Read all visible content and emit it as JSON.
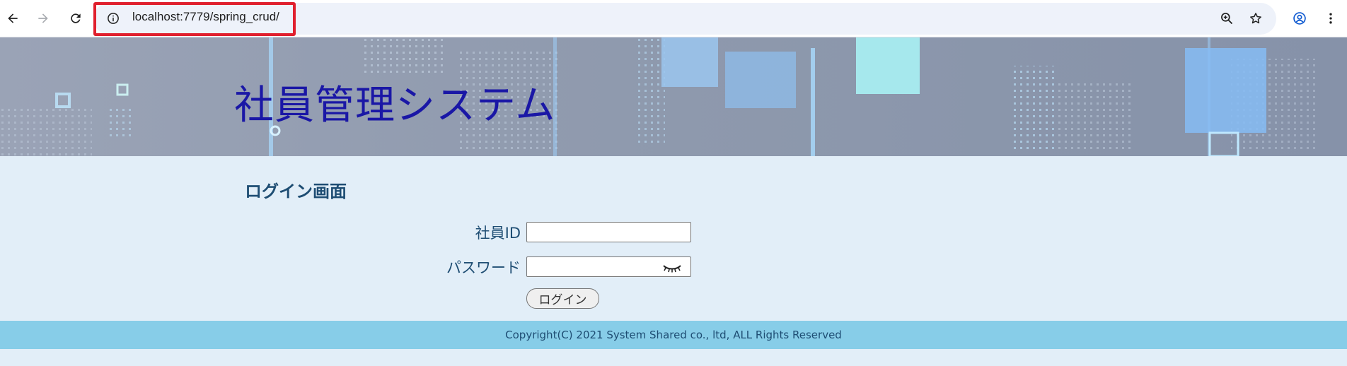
{
  "browser": {
    "url": "localhost:7779/spring_crud/",
    "icons": {
      "back": "arrow-left-icon",
      "forward": "arrow-right-icon",
      "reload": "reload-icon",
      "site_info": "info-icon",
      "zoom": "zoom-in-icon",
      "bookmark": "star-icon",
      "profile": "profile-icon",
      "menu": "kebab-menu-icon"
    }
  },
  "banner": {
    "title": "社員管理システム"
  },
  "login": {
    "heading": "ログイン画面",
    "employee_id_label": "社員ID",
    "employee_id_value": "",
    "password_label": "パスワード",
    "password_value": "",
    "password_toggle_icon": "eye-closed-icon",
    "submit_label": "ログイン"
  },
  "footer": {
    "copyright": "Copyright(C) 2021 System Shared co., ltd, ALL Rights Reserved"
  },
  "colors": {
    "title": "#1a17a6",
    "heading": "#1e4d73",
    "content_bg": "#e2eef8",
    "footer_bg": "#87cde8",
    "highlight": "#e0202e"
  }
}
